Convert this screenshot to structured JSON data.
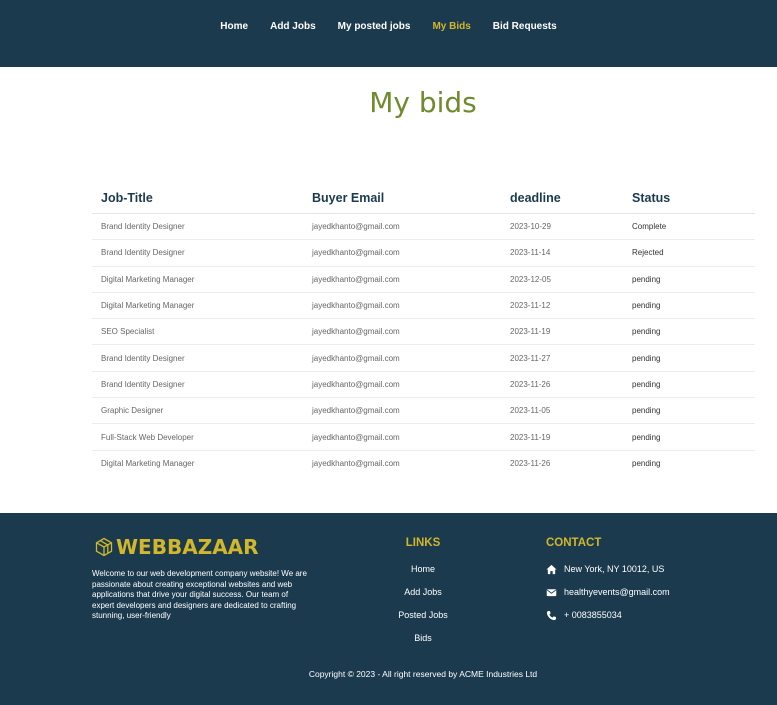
{
  "nav": {
    "items": [
      {
        "label": "Home",
        "active": false
      },
      {
        "label": "Add Jobs",
        "active": false
      },
      {
        "label": "My posted jobs",
        "active": false
      },
      {
        "label": "My Bids",
        "active": true
      },
      {
        "label": "Bid Requests",
        "active": false
      }
    ]
  },
  "page": {
    "title": "My bids"
  },
  "table": {
    "headers": [
      "Job-Title",
      "Buyer Email",
      "deadline",
      "Status"
    ],
    "rows": [
      [
        "Brand Identity Designer",
        "jayedkhanto@gmail.com",
        "2023-10-29",
        "Complete"
      ],
      [
        "Brand Identity Designer",
        "jayedkhanto@gmail.com",
        "2023-11-14",
        "Rejected"
      ],
      [
        "Digital Marketing Manager",
        "jayedkhanto@gmail.com",
        "2023-12-05",
        "pending"
      ],
      [
        "Digital Marketing Manager",
        "jayedkhanto@gmail.com",
        "2023-11-12",
        "pending"
      ],
      [
        "SEO Specialist",
        "jayedkhanto@gmail.com",
        "2023-11-19",
        "pending"
      ],
      [
        "Brand Identity Designer",
        "jayedkhanto@gmail.com",
        "2023-11-27",
        "pending"
      ],
      [
        "Brand Identity Designer",
        "jayedkhanto@gmail.com",
        "2023-11-26",
        "pending"
      ],
      [
        "Graphic Designer",
        "jayedkhanto@gmail.com",
        "2023-11-05",
        "pending"
      ],
      [
        "Full-Stack Web Developer",
        "jayedkhanto@gmail.com",
        "2023-11-19",
        "pending"
      ],
      [
        "Digital Marketing Manager",
        "jayedkhanto@gmail.com",
        "2023-11-26",
        "pending"
      ]
    ]
  },
  "footer": {
    "logo_text": "WEBBAZAAR",
    "logo_icon": "hexagon-cube-icon",
    "about": "Welcome to our web development company website! We are passionate about creating exceptional websites and web applications that drive your digital success. Our team of expert developers and designers are dedicated to crafting stunning, user-friendly",
    "links_title": "LINKS",
    "links": [
      "Home",
      "Add Jobs",
      "Posted Jobs",
      "Bids"
    ],
    "contact_title": "CONTACT",
    "contact": [
      {
        "icon": "home-icon",
        "text": "New York, NY 10012, US"
      },
      {
        "icon": "envelope-icon",
        "text": "healthyevents@gmail.com"
      },
      {
        "icon": "phone-icon",
        "text": "+ 0083855034"
      }
    ],
    "copyright": "Copyright © 2023 - All right reserved by ACME Industries Ltd"
  },
  "colors": {
    "navbar_bg": "#1b3a4e",
    "accent_gold": "#d2b72c",
    "title_olive": "#6f8a2f"
  }
}
